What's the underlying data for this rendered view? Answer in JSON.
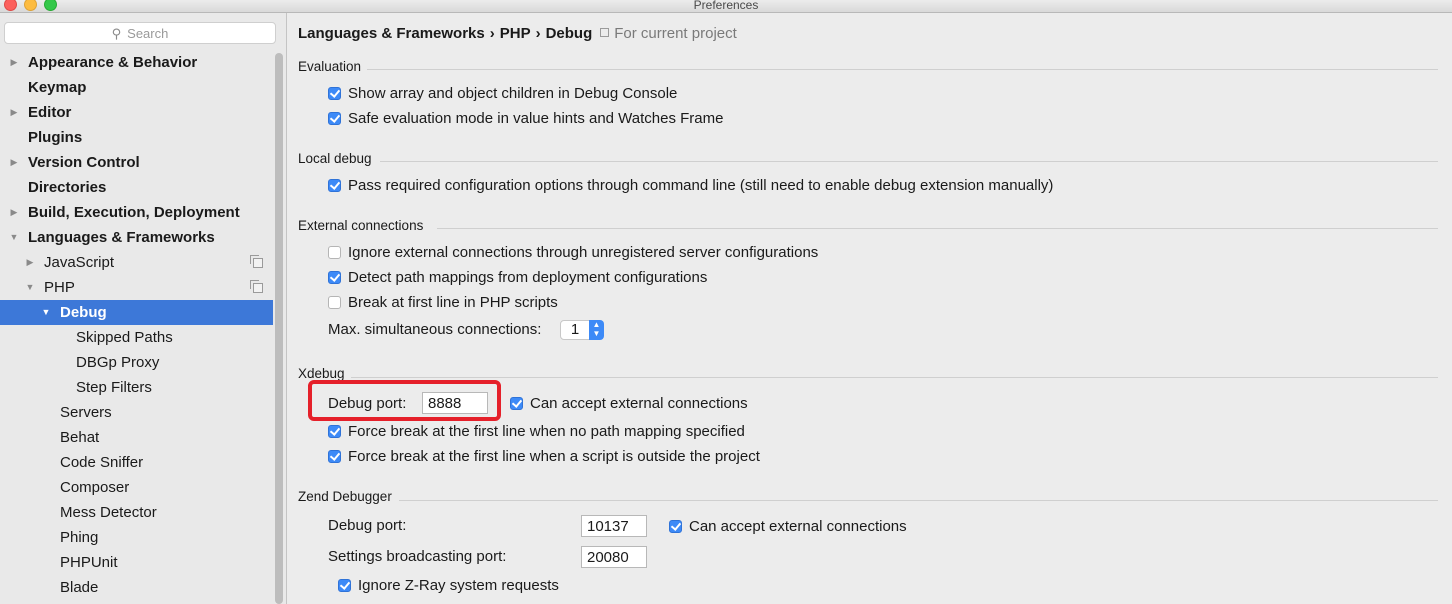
{
  "window": {
    "title": "Preferences"
  },
  "search": {
    "placeholder": "Search"
  },
  "sidebar": {
    "items": [
      {
        "label": "Appearance & Behavior",
        "arrow": "▶"
      },
      {
        "label": "Keymap",
        "arrow": ""
      },
      {
        "label": "Editor",
        "arrow": "▶"
      },
      {
        "label": "Plugins",
        "arrow": ""
      },
      {
        "label": "Version Control",
        "arrow": "▶"
      },
      {
        "label": "Directories",
        "arrow": ""
      },
      {
        "label": "Build, Execution, Deployment",
        "arrow": "▶"
      },
      {
        "label": "Languages & Frameworks",
        "arrow": "▼"
      },
      {
        "label": "JavaScript",
        "arrow": "▶"
      },
      {
        "label": "PHP",
        "arrow": "▼"
      },
      {
        "label": "Debug",
        "arrow": "▼"
      },
      {
        "label": "Skipped Paths",
        "arrow": ""
      },
      {
        "label": "DBGp Proxy",
        "arrow": ""
      },
      {
        "label": "Step Filters",
        "arrow": ""
      },
      {
        "label": "Servers",
        "arrow": ""
      },
      {
        "label": "Behat",
        "arrow": ""
      },
      {
        "label": "Code Sniffer",
        "arrow": ""
      },
      {
        "label": "Composer",
        "arrow": ""
      },
      {
        "label": "Mess Detector",
        "arrow": ""
      },
      {
        "label": "Phing",
        "arrow": ""
      },
      {
        "label": "PHPUnit",
        "arrow": ""
      },
      {
        "label": "Blade",
        "arrow": ""
      }
    ]
  },
  "breadcrumb": {
    "part1": "Languages & Frameworks",
    "part2": "PHP",
    "part3": "Debug",
    "separator": "›",
    "scope": "For current project"
  },
  "evaluation": {
    "title": "Evaluation",
    "show_array": {
      "label": "Show array and object children in Debug Console",
      "checked": true
    },
    "safe_eval": {
      "label": "Safe evaluation mode in value hints and Watches Frame",
      "checked": true
    }
  },
  "local_debug": {
    "title": "Local debug",
    "pass_options": {
      "label": "Pass required configuration options through command line (still need to enable debug extension manually)",
      "checked": true
    }
  },
  "external": {
    "title": "External connections",
    "ignore": {
      "label": "Ignore external connections through unregistered server configurations",
      "checked": false
    },
    "detect": {
      "label": "Detect path mappings from deployment configurations",
      "checked": true
    },
    "break_first": {
      "label": "Break at first line in PHP scripts",
      "checked": false
    },
    "max_label": "Max. simultaneous connections:",
    "max_value": "1"
  },
  "xdebug": {
    "title": "Xdebug",
    "port_label": "Debug port:",
    "port_value": "8888",
    "accept": {
      "label": "Can accept external connections",
      "checked": true
    },
    "force_no_mapping": {
      "label": "Force break at the first line when no path mapping specified",
      "checked": true
    },
    "force_outside": {
      "label": "Force break at the first line when a script is outside the project",
      "checked": true
    }
  },
  "zend": {
    "title": "Zend Debugger",
    "port_label": "Debug port:",
    "port_value": "10137",
    "accept": {
      "label": "Can accept external connections",
      "checked": true
    },
    "broadcast_label": "Settings broadcasting port:",
    "broadcast_value": "20080",
    "ignore_zray": {
      "label": "Ignore Z-Ray system requests",
      "checked": true
    }
  },
  "colors": {
    "selection": "#3d78d8",
    "checkbox": "#3d8af7",
    "highlight": "#e5202a"
  }
}
